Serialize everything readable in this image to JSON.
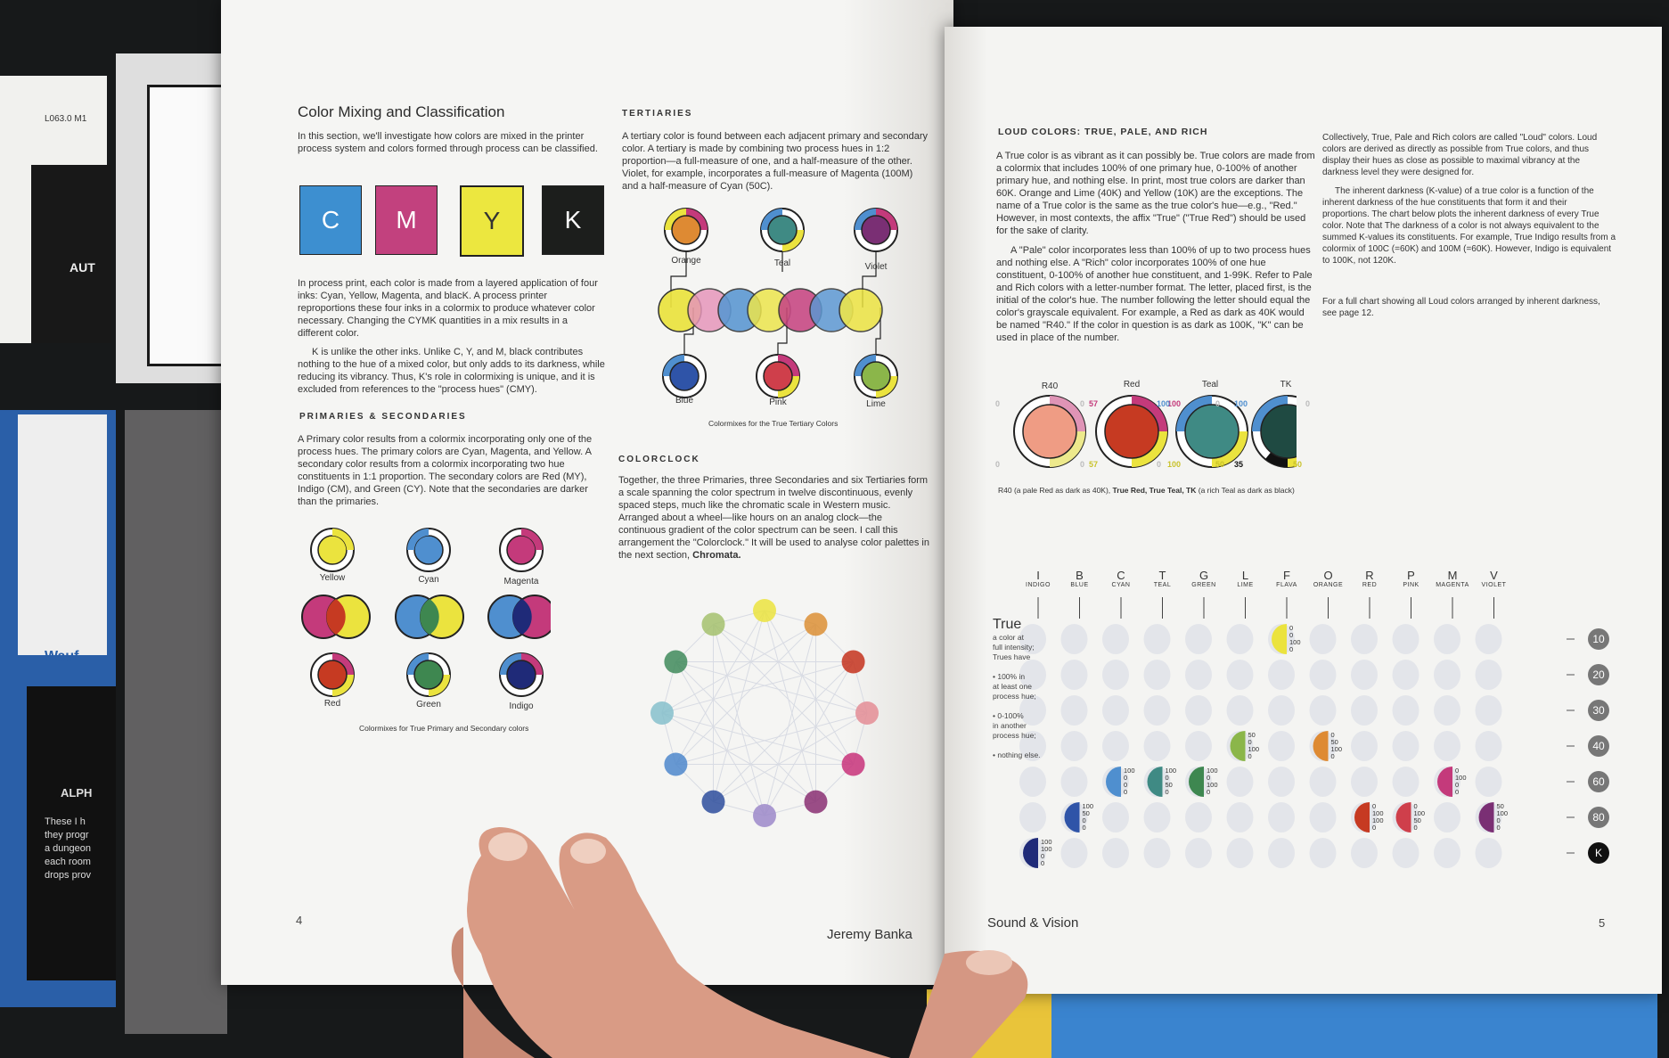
{
  "left_page": {
    "title": "Color Mixing and Classification",
    "intro": "In this section, we'll investigate how colors are mixed in the printer process system and colors formed through process can be classified.",
    "cmyk_tiles": [
      {
        "letter": "C",
        "color": "#3d8fd0"
      },
      {
        "letter": "M",
        "color": "#c2417e"
      },
      {
        "letter": "Y",
        "color": "#ece73f"
      },
      {
        "letter": "K",
        "color": "#1c1e1c"
      }
    ],
    "para1": "In process print, each color is made from a layered application of four inks: Cyan, Yellow, Magenta, and blacK. A process printer reproportions these four inks in a colormix to produce whatever color necessary. Changing the CYMK quantities in a mix results in a different color.",
    "para2": "K is unlike the other inks. Unlike C, Y, and M, black contributes nothing to the hue of a mixed color, but only adds to its darkness, while reducing its vibrancy. Thus, K's role in colormixing is unique, and it is excluded from references to the \"process hues\" (CMY).",
    "primaries_heading": "PRIMARIES & SECONDARIES",
    "primaries_text": "A Primary color results from a colormix incorporating only one of the process hues. The primary colors are Cyan, Magenta, and Yellow. A secondary color results from a colormix incorporating two hue constituents in 1:1 proportion. The secondary colors are Red (MY), Indigo (CM), and Green (CY). Note that the secondaries are darker than the primaries.",
    "primary_labels": [
      "Yellow",
      "Cyan",
      "Magenta"
    ],
    "secondary_labels": [
      "Red",
      "Green",
      "Indigo"
    ],
    "primary_caption": "Colormixes for True Primary and Secondary colors",
    "tertiaries_heading": "TERTIARIES",
    "tertiaries_text": "A tertiary color is found between each adjacent primary and secondary color. A tertiary is made by combining two process hues in 1:2 proportion—a full-measure of one, and a half-measure of the other. Violet, for example, incorporates a full-measure of Magenta (100M) and a half-measure of Cyan (50C).",
    "tertiary_top_labels": [
      "Orange",
      "Teal",
      "Violet"
    ],
    "tertiary_bottom_labels": [
      "Blue",
      "Pink",
      "Lime"
    ],
    "tertiary_caption": "Colormixes for the True Tertiary Colors",
    "colorclock_heading": "COLORCLOCK",
    "colorclock_text_a": "Together, the three Primaries, three Secondaries and six Tertiaries form a scale spanning the color spectrum in twelve discontinuous, evenly spaced steps, much like the chromatic scale in Western music. Arranged about a wheel—like hours on an analog clock—the continuous gradient of the color spectrum can be seen. I call this arrangement the \"Colorclock.\" It will be used to analyse color palettes in the next section,",
    "colorclock_text_b": "Chromata.",
    "clock_colors": [
      "#ebe33e",
      "#dc8f35",
      "#c4331d",
      "#e48d95",
      "#c8327a",
      "#8a2f72",
      "#9c88c9",
      "#2e4d9c",
      "#4e87cb",
      "#86bfcb",
      "#3f8a5a",
      "#a5c16d"
    ],
    "page_number": "4",
    "footer": "Jeremy Banka"
  },
  "right_page": {
    "heading": "LOUD COLORS: TRUE, PALE, AND RICH",
    "col1": "A True color is as vibrant as it can possibly be. True colors are made from a colormix that includes 100% of one primary hue, 0-100% of another primary hue, and nothing else. In print, most true colors are darker than 60K. Orange and Lime (40K) and Yellow (10K) are the exceptions. The name of a True color is the same as the true color's hue—e.g., \"Red.\" However, in most contexts, the affix \"True\" (\"True Red\") should be used for the sake of clarity.",
    "col1b": "A \"Pale\" color incorporates less than 100% of up to two process hues and nothing else. A \"Rich\" color incorporates 100% of one hue constituent, 0-100% of another hue constituent, and 1-99K. Refer to Pale and Rich colors with a letter-number format. The letter, placed first, is the initial of the color's hue. The number following the letter should equal the color's grayscale equivalent. For example, a Red as dark as 40K would be named \"R40.\" If the color in question is as dark as 100K, \"K\" can be used in place of the number.",
    "col2": "Collectively, True, Pale and Rich colors are called \"Loud\" colors. Loud colors are derived as directly as possible from True colors, and thus display their hues as close as possible to maximal vibrancy at the darkness level they were designed for.",
    "col2b": "The inherent darkness (K-value) of a true color is a function of the inherent darkness of the hue constituents that form it and their proportions. The chart below plots the inherent darkness of every True color. Note that The darkness of a color is not always equivalent to the summed K-values its constituents. For example, True Indigo results from a colormix of 100C (=60K) and 100M (=60K). However, Indigo is equivalent to 100K, not 120K.",
    "col2c": "For a full chart showing all Loud colors arranged by inherent darkness, see page 12.",
    "sample_labels": [
      "R40",
      "Red",
      "Teal",
      "TK"
    ],
    "sample_values": [
      {
        "tl": "0",
        "tr": "57",
        "bl": "0",
        "br": "57"
      },
      {
        "tl": "0",
        "tr": "100",
        "bl": "0",
        "br": "100"
      },
      {
        "tl": "100",
        "tr": "0",
        "bl": "0",
        "br": "50"
      },
      {
        "tl": "100",
        "tr": "0",
        "bl": "35",
        "br": "50"
      }
    ],
    "sample_caption_a": "R40",
    "sample_caption_b": "(a pale Red as dark as 40K),",
    "sample_caption_c": "True Red, True Teal, TK",
    "sample_caption_d": "(a rich Teal as dark as black)",
    "columns": [
      {
        "letter": "I",
        "name": "INDIGO"
      },
      {
        "letter": "B",
        "name": "BLUE"
      },
      {
        "letter": "C",
        "name": "CYAN"
      },
      {
        "letter": "T",
        "name": "TEAL"
      },
      {
        "letter": "G",
        "name": "GREEN"
      },
      {
        "letter": "L",
        "name": "LIME"
      },
      {
        "letter": "F",
        "name": "FLAVA"
      },
      {
        "letter": "O",
        "name": "ORANGE"
      },
      {
        "letter": "R",
        "name": "RED"
      },
      {
        "letter": "P",
        "name": "PINK"
      },
      {
        "letter": "M",
        "name": "MAGENTA"
      },
      {
        "letter": "V",
        "name": "VIOLET"
      }
    ],
    "darkness_levels": [
      "10",
      "20",
      "30",
      "40",
      "60",
      "80",
      "K"
    ],
    "true_title": "True",
    "true_desc": [
      "a color at",
      "full intensity;",
      "Trues have",
      "",
      "• 100% in",
      "at least one",
      "process hue;",
      "",
      "• 0-100%",
      "in another",
      "process hue;",
      "",
      "• nothing else."
    ],
    "true_colors": [
      {
        "col": 0,
        "row": 6,
        "color": "#1f2a78",
        "values": [
          "100",
          "100",
          "0",
          "0"
        ]
      },
      {
        "col": 1,
        "row": 5,
        "color": "#2f54a8",
        "values": [
          "100",
          "50",
          "0",
          "0"
        ]
      },
      {
        "col": 2,
        "row": 4,
        "color": "#4f8fcf",
        "values": [
          "100",
          "0",
          "0",
          "0"
        ]
      },
      {
        "col": 3,
        "row": 4,
        "color": "#3f8a84",
        "values": [
          "100",
          "0",
          "50",
          "0"
        ]
      },
      {
        "col": 4,
        "row": 4,
        "color": "#3e8750",
        "values": [
          "100",
          "0",
          "100",
          "0"
        ]
      },
      {
        "col": 5,
        "row": 3,
        "color": "#8bb64a",
        "values": [
          "50",
          "0",
          "100",
          "0"
        ]
      },
      {
        "col": 6,
        "row": 0,
        "color": "#ebe33e",
        "values": [
          "0",
          "0",
          "100",
          "0"
        ]
      },
      {
        "col": 7,
        "row": 3,
        "color": "#de8a33",
        "values": [
          "0",
          "50",
          "100",
          "0"
        ]
      },
      {
        "col": 8,
        "row": 5,
        "color": "#c63a22",
        "values": [
          "0",
          "100",
          "100",
          "0"
        ]
      },
      {
        "col": 9,
        "row": 5,
        "color": "#cf3f4b",
        "values": [
          "0",
          "100",
          "50",
          "0"
        ]
      },
      {
        "col": 10,
        "row": 4,
        "color": "#c43a7b",
        "values": [
          "0",
          "100",
          "0",
          "0"
        ]
      },
      {
        "col": 11,
        "row": 5,
        "color": "#7a2f74",
        "values": [
          "50",
          "100",
          "0",
          "0"
        ]
      }
    ],
    "page_number": "5",
    "footer": "Sound & Vision"
  },
  "background": {
    "stack_label": "L063.0 M1",
    "book_label_1": "AUT",
    "book_label_2": "ALPH",
    "book_text": [
      "These I h",
      "they progr",
      "a dungeon",
      "each room",
      "drops prov"
    ],
    "book_label_3": "Wauf"
  }
}
